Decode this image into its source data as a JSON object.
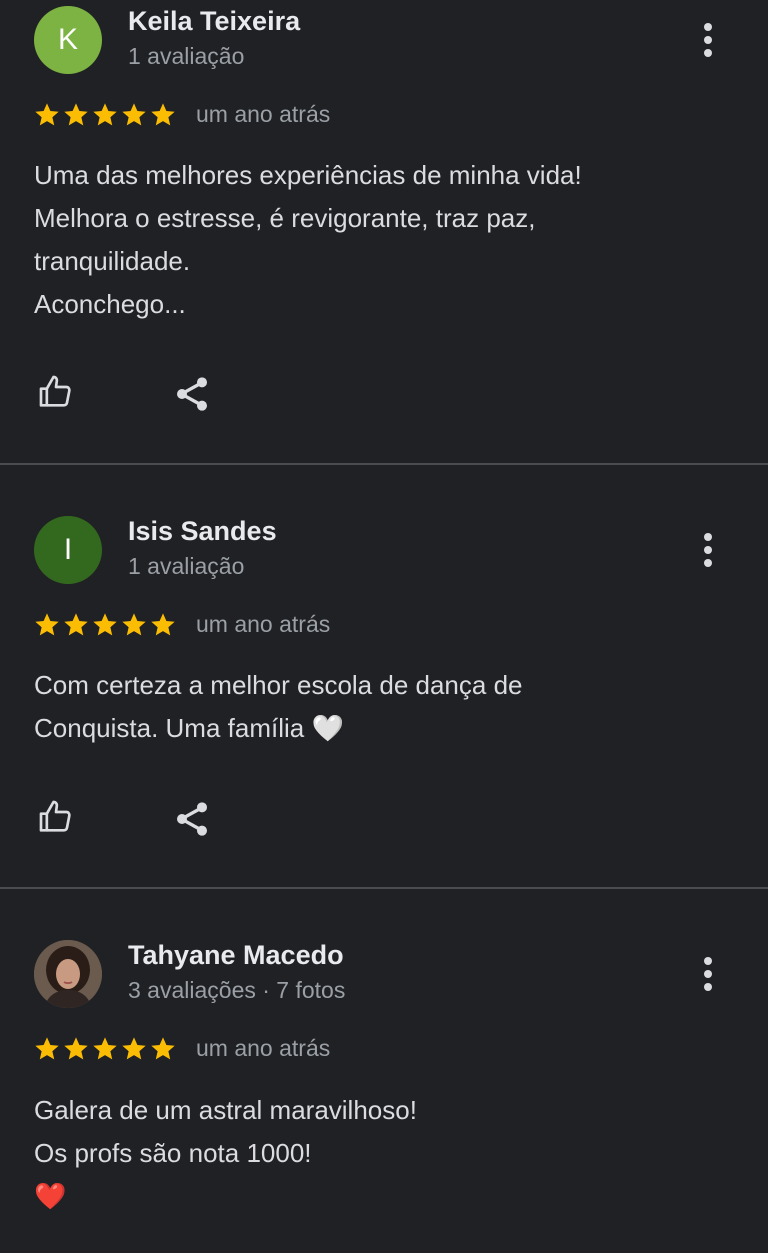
{
  "colors": {
    "background": "#202124",
    "star": "#fbbc04",
    "avatar_k": "#7cb342",
    "avatar_i": "#33691e"
  },
  "reviews": [
    {
      "author": "Keila Teixeira",
      "avatar_letter": "K",
      "meta": "1 avaliação",
      "rating": 5,
      "when": "um ano atrás",
      "text": "Uma das melhores experiências de minha vida!\nMelhora o estresse, é revigorante, traz paz,\ntranquilidade.\nAconchego...",
      "actions": [
        "thumbs-up-icon",
        "share-icon"
      ]
    },
    {
      "author": "Isis Sandes",
      "avatar_letter": "I",
      "meta": "1 avaliação",
      "rating": 5,
      "when": "um ano atrás",
      "text": "Com certeza a melhor escola de dança de\nConquista. Uma família 🤍",
      "actions": [
        "thumbs-up-icon",
        "share-icon"
      ]
    },
    {
      "author": "Tahyane Macedo",
      "avatar_letter": "",
      "meta": "3 avaliações · 7 fotos",
      "rating": 5,
      "when": "um ano atrás",
      "text": "Galera de um astral maravilhoso!\nOs profs são nota 1000!\n❤️",
      "actions": []
    }
  ]
}
